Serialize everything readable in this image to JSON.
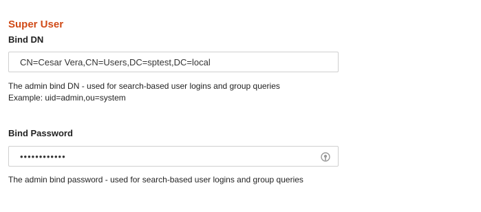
{
  "super_user": {
    "section_title": "Super User",
    "bind_dn": {
      "label": "Bind DN",
      "value": "CN=Cesar Vera,CN=Users,DC=sptest,DC=local",
      "help_line_1": "The admin bind DN - used for search-based user logins and group queries",
      "help_line_2": "Example: uid=admin,ou=system"
    },
    "bind_password": {
      "label": "Bind Password",
      "value": "••••••••••••",
      "help": "The admin bind password - used for search-based user logins and group queries",
      "reveal_icon": "eye-reveal-icon"
    }
  },
  "colors": {
    "section_title": "#d04a17",
    "input_border": "#cfcfcf",
    "icon": "#999999"
  }
}
